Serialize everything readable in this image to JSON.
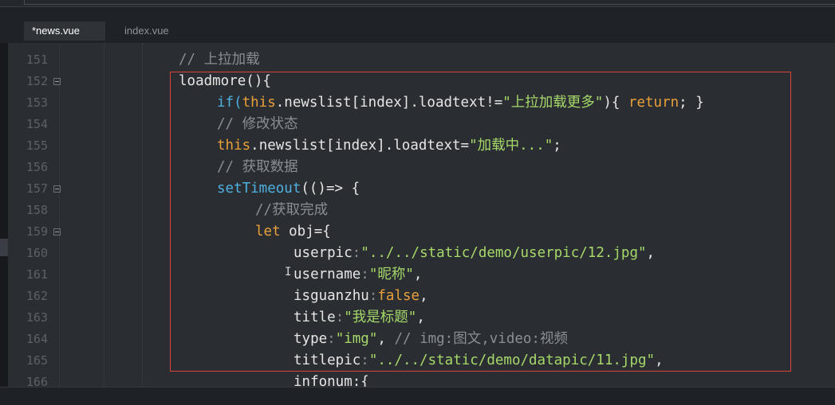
{
  "tabs": [
    {
      "label": "*news.vue",
      "active": true
    },
    {
      "label": "index.vue",
      "active": false
    }
  ],
  "colors": {
    "background": "#2a2d31",
    "comment": "#8a8f95",
    "keyword": "#e8a03a",
    "function": "#4fb0e0",
    "string": "#a6d96a",
    "highlight_border": "#d9443b"
  },
  "lines": [
    {
      "num": "151",
      "fold": false,
      "tokens": [
        {
          "t": "// 上拉加载",
          "c": "comment"
        }
      ]
    },
    {
      "num": "152",
      "fold": true,
      "tokens": [
        {
          "t": "loadmore(){",
          "c": "prop"
        }
      ]
    },
    {
      "num": "153",
      "fold": false,
      "tokens": [
        {
          "t": "if(",
          "c": "fn"
        },
        {
          "t": "this",
          "c": "kw"
        },
        {
          "t": ".newslist[index].loadtext!=",
          "c": "prop"
        },
        {
          "t": "\"上拉加载更多\"",
          "c": "str"
        },
        {
          "t": "){ ",
          "c": "punc"
        },
        {
          "t": "return",
          "c": "ret"
        },
        {
          "t": "; }",
          "c": "punc"
        }
      ]
    },
    {
      "num": "154",
      "fold": false,
      "tokens": [
        {
          "t": "// 修改状态",
          "c": "comment"
        }
      ]
    },
    {
      "num": "155",
      "fold": false,
      "tokens": [
        {
          "t": "this",
          "c": "kw"
        },
        {
          "t": ".newslist[index].loadtext=",
          "c": "prop"
        },
        {
          "t": "\"加载中...\"",
          "c": "str"
        },
        {
          "t": ";",
          "c": "punc"
        }
      ]
    },
    {
      "num": "156",
      "fold": false,
      "tokens": [
        {
          "t": "// 获取数据",
          "c": "comment"
        }
      ]
    },
    {
      "num": "157",
      "fold": true,
      "tokens": [
        {
          "t": "setTimeout",
          "c": "fn"
        },
        {
          "t": "(()=> {",
          "c": "punc"
        }
      ]
    },
    {
      "num": "158",
      "fold": false,
      "tokens": [
        {
          "t": "//获取完成",
          "c": "comment"
        }
      ]
    },
    {
      "num": "159",
      "fold": true,
      "tokens": [
        {
          "t": "let",
          "c": "kw"
        },
        {
          "t": " obj={",
          "c": "prop"
        }
      ]
    },
    {
      "num": "160",
      "fold": false,
      "tokens": [
        {
          "t": "userpic",
          "c": "prop"
        },
        {
          "t": ":",
          "c": "comment"
        },
        {
          "t": "\"../../static/demo/userpic/12.jpg\"",
          "c": "str"
        },
        {
          "t": ",",
          "c": "punc"
        }
      ]
    },
    {
      "num": "161",
      "fold": false,
      "tokens": [
        {
          "t": "username",
          "c": "prop"
        },
        {
          "t": ":",
          "c": "comment"
        },
        {
          "t": "\"昵称\"",
          "c": "str"
        },
        {
          "t": ",",
          "c": "punc"
        }
      ]
    },
    {
      "num": "162",
      "fold": false,
      "tokens": [
        {
          "t": "isguanzhu",
          "c": "prop"
        },
        {
          "t": ":",
          "c": "comment"
        },
        {
          "t": "false",
          "c": "kw"
        },
        {
          "t": ",",
          "c": "punc"
        }
      ]
    },
    {
      "num": "163",
      "fold": false,
      "tokens": [
        {
          "t": "title",
          "c": "prop"
        },
        {
          "t": ":",
          "c": "comment"
        },
        {
          "t": "\"我是标题\"",
          "c": "str"
        },
        {
          "t": ",",
          "c": "punc"
        }
      ]
    },
    {
      "num": "164",
      "fold": false,
      "tokens": [
        {
          "t": "type",
          "c": "prop"
        },
        {
          "t": ":",
          "c": "comment"
        },
        {
          "t": "\"img\"",
          "c": "str"
        },
        {
          "t": ", ",
          "c": "punc"
        },
        {
          "t": "// img:图文,video:视频",
          "c": "comment"
        }
      ]
    },
    {
      "num": "165",
      "fold": false,
      "tokens": [
        {
          "t": "titlepic",
          "c": "prop"
        },
        {
          "t": ":",
          "c": "comment"
        },
        {
          "t": "\"../../static/demo/datapic/11.jpg\"",
          "c": "str"
        },
        {
          "t": ",",
          "c": "punc"
        }
      ]
    },
    {
      "num": "166",
      "fold": false,
      "tokens": [
        {
          "t": "infonum:{",
          "c": "prop"
        }
      ]
    }
  ]
}
